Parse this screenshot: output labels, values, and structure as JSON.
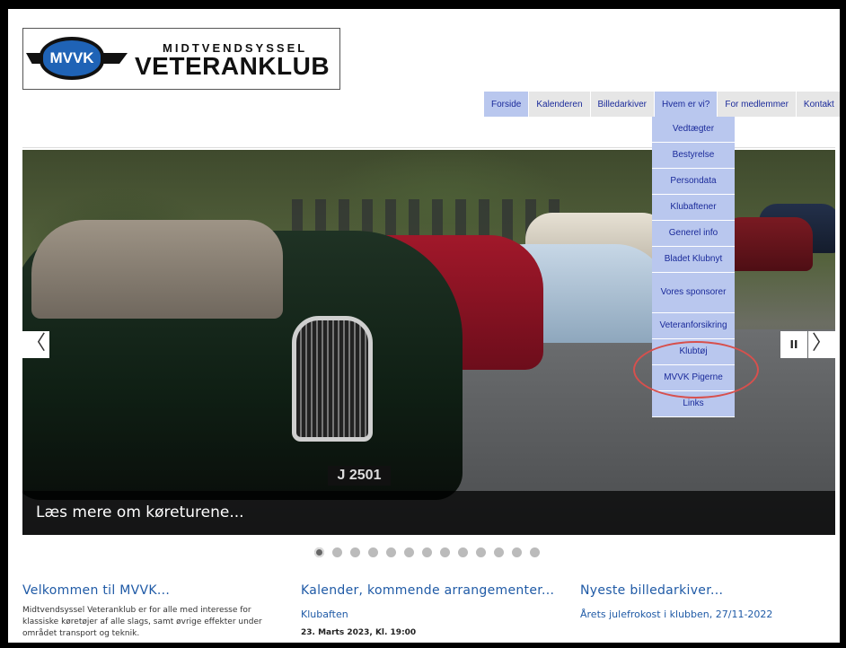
{
  "logo": {
    "badge": "MVVK",
    "line1": "MIDTVENDSYSSEL",
    "line2": "VETERANKLUB"
  },
  "nav": [
    {
      "label": "Forside"
    },
    {
      "label": "Kalenderen"
    },
    {
      "label": "Billedarkiver"
    },
    {
      "label": "Hvem er vi?"
    },
    {
      "label": "For medlemmer"
    },
    {
      "label": "Kontakt"
    }
  ],
  "dropdown": [
    "Vedtægter",
    "Bestyrelse",
    "Persondata",
    "Klubaftener",
    "Generel info",
    "Bladet Klubnyt",
    "Vores sponsorer",
    "Veteranforsikring",
    "Klubtøj",
    "MVVK Pigerne",
    "Links"
  ],
  "slider": {
    "caption": "Læs mere om køreturene...",
    "plate": "J 2501",
    "prev": "〈",
    "next": "〉",
    "pause": "II",
    "slide_count": 13,
    "active_slide": 1
  },
  "columns": {
    "welcome": {
      "title": "Velkommen til MVVK...",
      "text": "Midtvendsyssel Veteranklub er for alle med interesse for klassiske køretøjer af alle slags, samt øvrige effekter under området transport og teknik."
    },
    "calendar": {
      "title": "Kalender, kommende arrangementer...",
      "event": "Klubaften",
      "date": "23. Marts 2023, Kl. 19:00"
    },
    "gallery": {
      "title": "Nyeste billedarkiver...",
      "latest": "Årets julefrokost i klubben, 27/11-2022"
    }
  }
}
